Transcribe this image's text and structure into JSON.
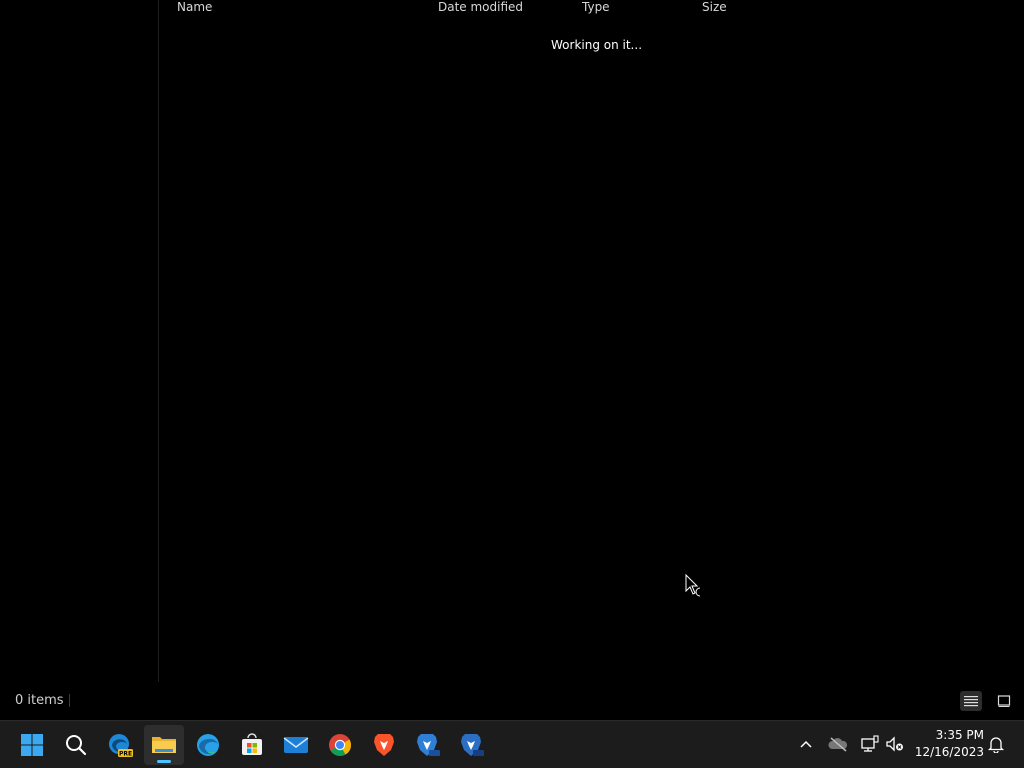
{
  "columns": {
    "name": "Name",
    "date_modified": "Date modified",
    "type": "Type",
    "size": "Size"
  },
  "loading_message": "Working on it...",
  "status": {
    "item_count": "0 items"
  },
  "taskbar": {
    "apps": [
      {
        "name": "start",
        "icon": "windows-logo-icon"
      },
      {
        "name": "search",
        "icon": "search-icon"
      },
      {
        "name": "edge-preview",
        "icon": "edge-preview-icon",
        "badge": "PRE"
      },
      {
        "name": "file-explorer",
        "icon": "folder-icon",
        "active": true
      },
      {
        "name": "edge",
        "icon": "edge-icon"
      },
      {
        "name": "microsoft-store",
        "icon": "store-icon"
      },
      {
        "name": "mail",
        "icon": "mail-icon"
      },
      {
        "name": "chrome",
        "icon": "chrome-icon"
      },
      {
        "name": "brave",
        "icon": "brave-icon"
      },
      {
        "name": "brave-beta",
        "icon": "brave-beta-icon"
      },
      {
        "name": "brave-nightly",
        "icon": "brave-nightly-icon"
      }
    ],
    "tray": [
      "chevron-up-icon",
      "onedrive-offline-icon",
      "network-icon",
      "volume-muted-icon",
      "notification-bell-icon"
    ],
    "time": "3:35 PM",
    "date": "12/16/2023"
  },
  "colors": {
    "accent": "#4cc2ff",
    "background": "#000000",
    "taskbar": "#1c1c1c"
  }
}
